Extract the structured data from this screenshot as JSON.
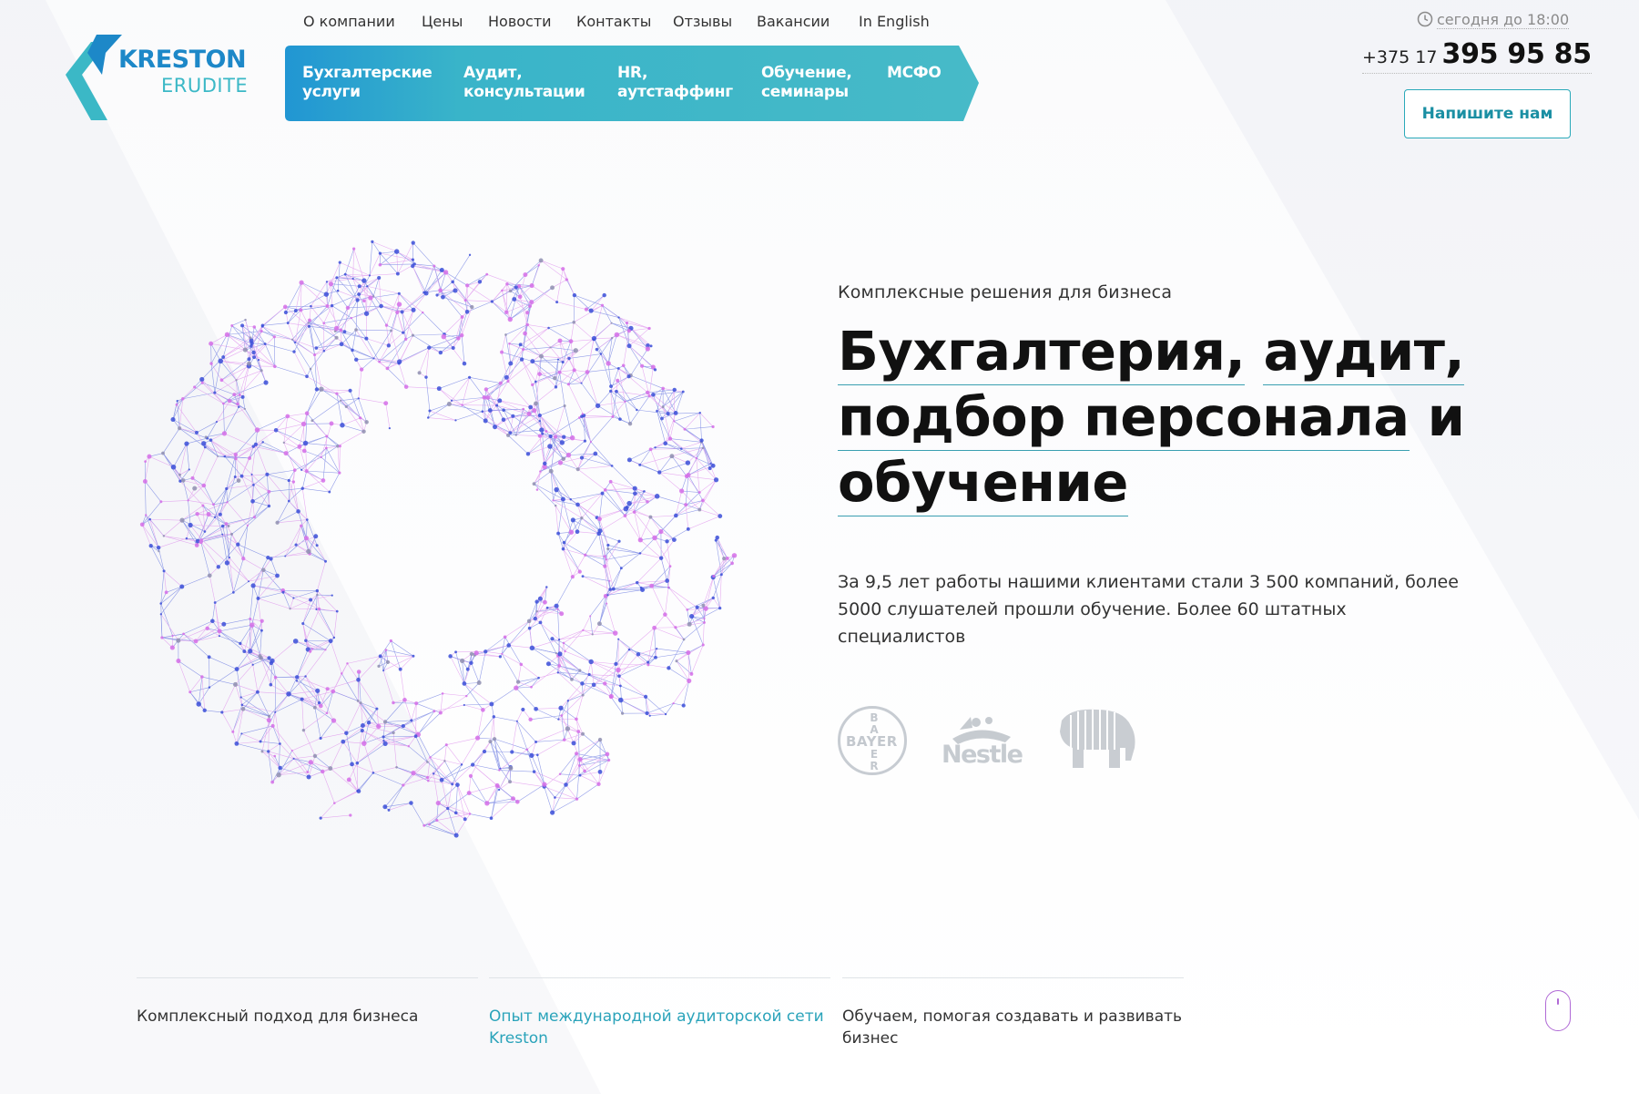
{
  "brand": {
    "name": "KRESTON",
    "sub": "ERUDITE",
    "colors": {
      "blue": "#1d88c8",
      "teal": "#3bb8c6",
      "accent": "#2aa3ba",
      "sphere_blue": "#3b4fd8",
      "sphere_pink": "#d56ee8"
    }
  },
  "topnav": [
    "О компании",
    "Цены",
    "Новости",
    "Контакты",
    "Отзывы",
    "Вакансии",
    "In English"
  ],
  "services": [
    {
      "line1": "Бухгалтерские",
      "line2": "услуги"
    },
    {
      "line1": "Аудит,",
      "line2": "консультации"
    },
    {
      "line1": "HR,",
      "line2": "аутстаффинг"
    },
    {
      "line1": "Обучение,",
      "line2": "семинары"
    },
    {
      "line1": "МСФО",
      "line2": ""
    }
  ],
  "contact": {
    "hours_icon": "clock-icon",
    "hours": "сегодня до 18:00",
    "phone_code": "+375 17",
    "phone_number": "395 95 85",
    "cta": "Напишите нам"
  },
  "hero": {
    "eyebrow": "Комплексные решения для бизнеса",
    "title_parts": [
      "Бухгалтерия,",
      "аудит,",
      "подбор персонала",
      "и",
      "обучение"
    ],
    "lead": "За 9,5 лет работы нашими клиентами стали 3 500 компаний, более 5000 слушателей прошли обучение. Более 60 штатных специалистов"
  },
  "clients": {
    "bayer": "BAYER",
    "bayer_v1": "B",
    "bayer_v2": "A",
    "bayer_v3": "E",
    "bayer_v4": "R",
    "nestle": "Nestle",
    "elephant_icon": "elephant-logo-icon"
  },
  "features": [
    {
      "text": "Комплексный подход для бизнеса",
      "active": false
    },
    {
      "text": "Опыт международной аудиторской сети Kreston",
      "active": true
    },
    {
      "text": "Обучаем, помогая создавать и развивать бизнес",
      "active": false
    }
  ],
  "scroll_icon": "mouse-scroll-icon"
}
